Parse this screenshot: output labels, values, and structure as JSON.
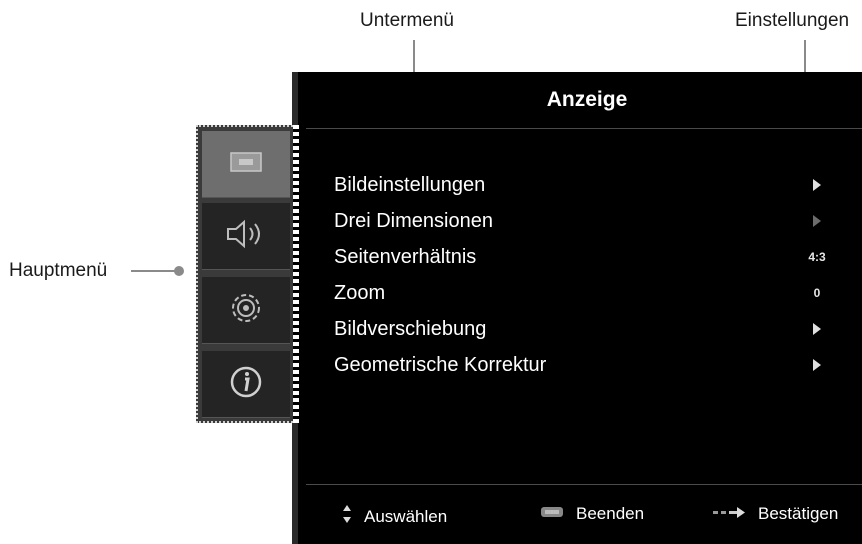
{
  "callouts": {
    "submenu": "Untermenü",
    "settings": "Einstellungen",
    "mainmenu": "Hauptmenü"
  },
  "osd": {
    "title": "Anzeige",
    "items": [
      {
        "label": "Bildeinstellungen",
        "value": "arrow"
      },
      {
        "label": "Drei Dimensionen",
        "value": "arrow-dim"
      },
      {
        "label": "Seitenverhältnis",
        "value": "4:3"
      },
      {
        "label": "Zoom",
        "value": "0"
      },
      {
        "label": "Bildverschiebung",
        "value": "arrow"
      },
      {
        "label": "Geometrische Korrektur",
        "value": "arrow"
      }
    ],
    "footer": {
      "select": "Auswählen",
      "exit": "Beenden",
      "confirm": "Bestätigen"
    }
  },
  "sidebar": {
    "items": [
      {
        "icon": "display-icon",
        "active": true
      },
      {
        "icon": "speaker-icon",
        "active": false
      },
      {
        "icon": "gear-icon",
        "active": false
      },
      {
        "icon": "info-icon",
        "active": false
      }
    ]
  }
}
